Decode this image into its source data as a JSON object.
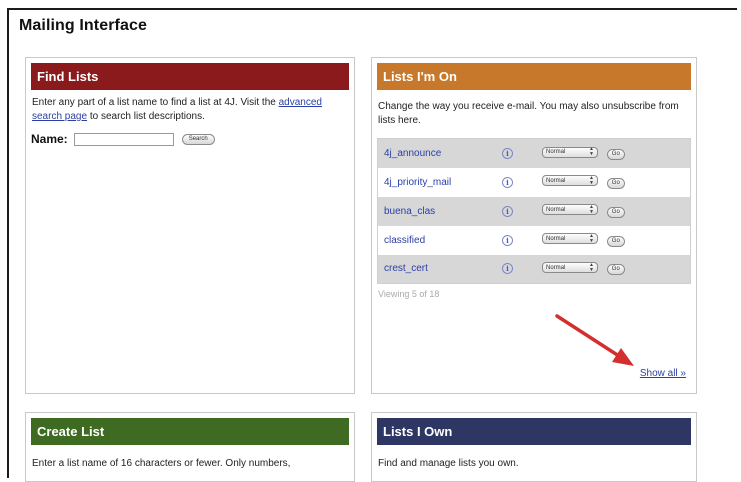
{
  "page": {
    "title": "Mailing Interface"
  },
  "find_lists": {
    "title": "Find Lists",
    "description_before": "Enter any part of a list name to find a list at 4J. Visit the ",
    "advanced_link": "advanced search page",
    "description_after": " to search list descriptions.",
    "name_label": "Name:",
    "name_value": "",
    "search_label": "Search"
  },
  "lists_im_on": {
    "title": "Lists I'm On",
    "description": "Change the way you receive e-mail. You may also unsubscribe from lists here.",
    "rows": [
      {
        "name": "4j_announce",
        "delivery": "Normal",
        "go": "Go"
      },
      {
        "name": "4j_priority_mail",
        "delivery": "Normal",
        "go": "Go"
      },
      {
        "name": "buena_clas",
        "delivery": "Normal",
        "go": "Go"
      },
      {
        "name": "classified",
        "delivery": "Normal",
        "go": "Go"
      },
      {
        "name": "crest_cert",
        "delivery": "Normal",
        "go": "Go"
      }
    ],
    "viewing": "Viewing 5 of 18",
    "show_all": "Show all »"
  },
  "create_list": {
    "title": "Create List",
    "description": "Enter a list name of 16 characters or fewer. Only numbers,"
  },
  "lists_i_own": {
    "title": "Lists I Own",
    "description": "Find and manage lists you own."
  },
  "colors": {
    "find_header": "#8b1a1d",
    "on_header": "#c8782a",
    "create_header": "#3f6a22",
    "own_header": "#2e3763",
    "link": "#2b3fa6",
    "annotation_arrow": "#d32f2f"
  },
  "icons": {
    "info": "info-icon",
    "select_arrows": "updown-icon",
    "annotation": "red-arrow-icon"
  }
}
